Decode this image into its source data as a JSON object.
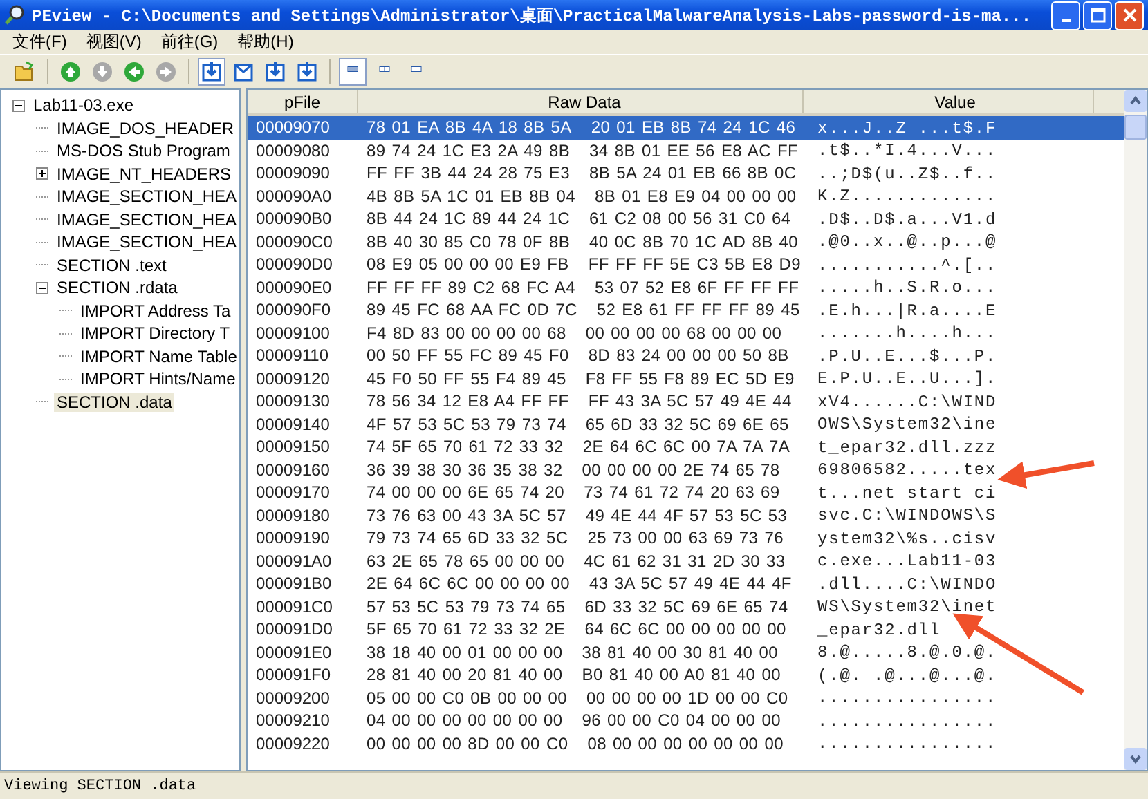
{
  "window": {
    "title": "PEview - C:\\Documents and Settings\\Administrator\\桌面\\PracticalMalwareAnalysis-Labs-password-is-ma..."
  },
  "menu": [
    "文件(F)",
    "视图(V)",
    "前往(G)",
    "帮助(H)"
  ],
  "toolbar": [
    {
      "kind": "open"
    },
    {
      "kind": "up",
      "disabled": false
    },
    {
      "kind": "down",
      "disabled": true
    },
    {
      "kind": "back",
      "disabled": false
    },
    {
      "kind": "forward",
      "disabled": true
    },
    {
      "kind": "doc-down",
      "pressed": true
    },
    {
      "kind": "doc",
      "pressed": false
    },
    {
      "kind": "doc-arrow",
      "pressed": false
    },
    {
      "kind": "doc-arrow",
      "pressed": false
    },
    {
      "kind": "view-bytes",
      "pressed": true
    },
    {
      "kind": "view-words",
      "pressed": false
    },
    {
      "kind": "view-dwords",
      "pressed": false
    }
  ],
  "tree": [
    {
      "label": "Lab11-03.exe",
      "selected": false,
      "expanded": true,
      "children": [
        {
          "label": "IMAGE_DOS_HEADER",
          "selected": false
        },
        {
          "label": "MS-DOS Stub Program",
          "selected": false
        },
        {
          "label": "IMAGE_NT_HEADERS",
          "selected": false,
          "expanded": false
        },
        {
          "label": "IMAGE_SECTION_HEA",
          "selected": false
        },
        {
          "label": "IMAGE_SECTION_HEA",
          "selected": false
        },
        {
          "label": "IMAGE_SECTION_HEA",
          "selected": false
        },
        {
          "label": "SECTION .text",
          "selected": false
        },
        {
          "label": "SECTION .rdata",
          "selected": false,
          "expanded": true,
          "children": [
            {
              "label": "IMPORT Address Ta",
              "selected": false
            },
            {
              "label": "IMPORT Directory T",
              "selected": false
            },
            {
              "label": "IMPORT Name Table",
              "selected": false
            },
            {
              "label": "IMPORT Hints/Name",
              "selected": false
            }
          ]
        },
        {
          "label": "SECTION .data",
          "selected": true
        }
      ]
    }
  ],
  "table": {
    "columns": [
      "pFile",
      "Raw Data",
      "Value"
    ],
    "rows": [
      {
        "pfile": "00009070",
        "raw": [
          "78 01 EA 8B 4A 18 8B 5A",
          "20 01 EB 8B 74 24 1C 46"
        ],
        "value": "x...J..Z ...t$.F",
        "selected": true
      },
      {
        "pfile": "00009080",
        "raw": [
          "89 74 24 1C E3 2A 49 8B",
          "34 8B 01 EE 56 E8 AC FF"
        ],
        "value": ".t$..*I.4...V...",
        "selected": false
      },
      {
        "pfile": "00009090",
        "raw": [
          "FF FF 3B 44 24 28 75 E3",
          "8B 5A 24 01 EB 66 8B 0C"
        ],
        "value": "..;D$(u..Z$..f..",
        "selected": false
      },
      {
        "pfile": "000090A0",
        "raw": [
          "4B 8B 5A 1C 01 EB 8B 04",
          "8B 01 E8 E9 04 00 00 00"
        ],
        "value": "K.Z.............",
        "selected": false
      },
      {
        "pfile": "000090B0",
        "raw": [
          "8B 44 24 1C 89 44 24 1C",
          "61 C2 08 00 56 31 C0 64"
        ],
        "value": ".D$..D$.a...V1.d",
        "selected": false
      },
      {
        "pfile": "000090C0",
        "raw": [
          "8B 40 30 85 C0 78 0F 8B",
          "40 0C 8B 70 1C AD 8B 40"
        ],
        "value": ".@0..x..@..p...@",
        "selected": false
      },
      {
        "pfile": "000090D0",
        "raw": [
          "08 E9 05 00 00 00 E9 FB",
          "FF FF FF 5E C3 5B E8 D9"
        ],
        "value": "...........^.[..",
        "selected": false
      },
      {
        "pfile": "000090E0",
        "raw": [
          "FF FF FF 89 C2 68 FC A4",
          "53 07 52 E8 6F FF FF FF"
        ],
        "value": ".....h..S.R.o...",
        "selected": false
      },
      {
        "pfile": "000090F0",
        "raw": [
          "89 45 FC 68 AA FC 0D 7C",
          "52 E8 61 FF FF FF 89 45"
        ],
        "value": ".E.h...|R.a....E",
        "selected": false
      },
      {
        "pfile": "00009100",
        "raw": [
          "F4 8D 83 00 00 00 00 68",
          "00 00 00 00 68 00 00 00"
        ],
        "value": ".......h....h...",
        "selected": false
      },
      {
        "pfile": "00009110",
        "raw": [
          "00 50 FF 55 FC 89 45 F0",
          "8D 83 24 00 00 00 50 8B"
        ],
        "value": ".P.U..E...$...P.",
        "selected": false
      },
      {
        "pfile": "00009120",
        "raw": [
          "45 F0 50 FF 55 F4 89 45",
          "F8 FF 55 F8 89 EC 5D E9"
        ],
        "value": "E.P.U..E..U...].",
        "selected": false
      },
      {
        "pfile": "00009130",
        "raw": [
          "78 56 34 12 E8 A4 FF FF",
          "FF 43 3A 5C 57 49 4E 44"
        ],
        "value": "xV4......C:\\WIND",
        "selected": false
      },
      {
        "pfile": "00009140",
        "raw": [
          "4F 57 53 5C 53 79 73 74",
          "65 6D 33 32 5C 69 6E 65"
        ],
        "value": "OWS\\System32\\ine",
        "selected": false
      },
      {
        "pfile": "00009150",
        "raw": [
          "74 5F 65 70 61 72 33 32",
          "2E 64 6C 6C 00 7A 7A 7A"
        ],
        "value": "t_epar32.dll.zzz",
        "selected": false
      },
      {
        "pfile": "00009160",
        "raw": [
          "36 39 38 30 36 35 38 32",
          "00 00 00 00 2E 74 65 78"
        ],
        "value": "69806582.....tex",
        "selected": false
      },
      {
        "pfile": "00009170",
        "raw": [
          "74 00 00 00 6E 65 74 20",
          "73 74 61 72 74 20 63 69"
        ],
        "value": "t...net start ci",
        "selected": false
      },
      {
        "pfile": "00009180",
        "raw": [
          "73 76 63 00 43 3A 5C 57",
          "49 4E 44 4F 57 53 5C 53"
        ],
        "value": "svc.C:\\WINDOWS\\S",
        "selected": false
      },
      {
        "pfile": "00009190",
        "raw": [
          "79 73 74 65 6D 33 32 5C",
          "25 73 00 00 63 69 73 76"
        ],
        "value": "ystem32\\%s..cisv",
        "selected": false
      },
      {
        "pfile": "000091A0",
        "raw": [
          "63 2E 65 78 65 00 00 00",
          "4C 61 62 31 31 2D 30 33"
        ],
        "value": "c.exe...Lab11-03",
        "selected": false
      },
      {
        "pfile": "000091B0",
        "raw": [
          "2E 64 6C 6C 00 00 00 00",
          "43 3A 5C 57 49 4E 44 4F"
        ],
        "value": ".dll....C:\\WINDO",
        "selected": false
      },
      {
        "pfile": "000091C0",
        "raw": [
          "57 53 5C 53 79 73 74 65",
          "6D 33 32 5C 69 6E 65 74"
        ],
        "value": "WS\\System32\\inet",
        "selected": false
      },
      {
        "pfile": "000091D0",
        "raw": [
          "5F 65 70 61 72 33 32 2E",
          "64 6C 6C 00 00 00 00 00"
        ],
        "value": "_epar32.dll",
        "selected": false
      },
      {
        "pfile": "000091E0",
        "raw": [
          "38 18 40 00 01 00 00 00",
          "38 81 40 00 30 81 40 00"
        ],
        "value": "8.@.....8.@.0.@.",
        "selected": false
      },
      {
        "pfile": "000091F0",
        "raw": [
          "28 81 40 00 20 81 40 00",
          "B0 81 40 00 A0 81 40 00"
        ],
        "value": "(.@. .@...@...@.",
        "selected": false
      },
      {
        "pfile": "00009200",
        "raw": [
          "05 00 00 C0 0B 00 00 00",
          "00 00 00 00 1D 00 00 C0"
        ],
        "value": "................",
        "selected": false
      },
      {
        "pfile": "00009210",
        "raw": [
          "04 00 00 00 00 00 00 00",
          "96 00 00 C0 04 00 00 00"
        ],
        "value": "................",
        "selected": false
      },
      {
        "pfile": "00009220",
        "raw": [
          "00 00 00 00 8D 00 00 C0",
          "08 00 00 00 00 00 00 00"
        ],
        "value": "................",
        "selected": false
      }
    ]
  },
  "annotations": [
    {
      "kind": "arrow"
    },
    {
      "kind": "arrow"
    }
  ],
  "status_bar": "Viewing SECTION .data"
}
